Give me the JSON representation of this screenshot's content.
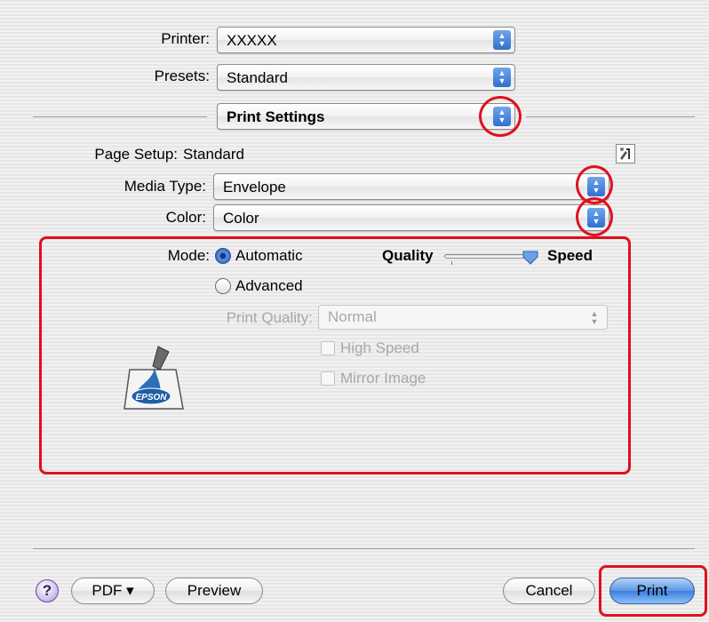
{
  "printer": {
    "label": "Printer:",
    "value": "XXXXX"
  },
  "presets": {
    "label": "Presets:",
    "value": "Standard"
  },
  "pane": {
    "value": "Print Settings"
  },
  "page_setup": {
    "label": "Page Setup:",
    "value": "Standard"
  },
  "media_type": {
    "label": "Media Type:",
    "value": "Envelope"
  },
  "color": {
    "label": "Color:",
    "value": "Color"
  },
  "mode": {
    "label": "Mode:",
    "automatic_label": "Automatic",
    "advanced_label": "Advanced",
    "selected": "Automatic"
  },
  "slider": {
    "left_label": "Quality",
    "right_label": "Speed",
    "value": 1.0
  },
  "print_quality": {
    "label": "Print Quality:",
    "value": "Normal"
  },
  "options": {
    "high_speed": "High Speed",
    "mirror_image": "Mirror Image"
  },
  "logo": {
    "text": "EPSON"
  },
  "footer": {
    "help": "?",
    "pdf": "PDF ▾",
    "preview": "Preview",
    "cancel": "Cancel",
    "print": "Print"
  },
  "colors": {
    "highlight": "#e0101e",
    "accent": "#3b7fe0"
  }
}
